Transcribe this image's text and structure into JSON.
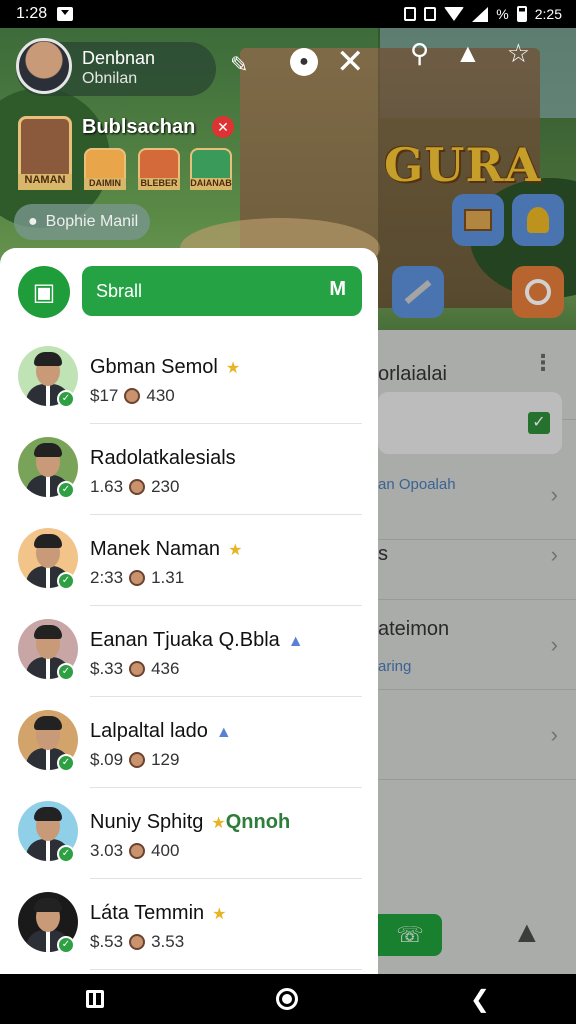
{
  "status_bar": {
    "time": "1:28",
    "right_text": "%",
    "battery_time": "2:25"
  },
  "header": {
    "profile_name": "Denbnan",
    "profile_sub": "Obnilan",
    "club_title": "Bublsachan",
    "club_avatar_label": "NAMAN",
    "mini_labels": [
      "DAIMIN",
      "BLEBER",
      "DAIANAB"
    ],
    "status_chip": "Bophie Manil",
    "icons": {
      "edit": "edit-icon",
      "chat_bubble": "chat-bubble-icon",
      "close": "close-icon"
    }
  },
  "scene": {
    "title": "GURA",
    "top_icons": [
      "search-icon",
      "notification-icon",
      "network-icon"
    ]
  },
  "drawer": {
    "chat_icon": "message-square-icon",
    "search_label": "Sbrall",
    "search_badge": "M",
    "friends": [
      {
        "name": "Gbman Semol",
        "amount": "$17",
        "count": "430",
        "badge": "star",
        "avatar_bg": "#bfe3b4"
      },
      {
        "name": "Radolatkalesials",
        "amount": "1.63",
        "count": "230",
        "badge": "",
        "avatar_bg": "#7aa35a"
      },
      {
        "name": "Manek Naman",
        "amount": "2:33",
        "count": "1.31",
        "badge": "star",
        "avatar_bg": "#f2c48a"
      },
      {
        "name": "Eanan Tjuaka Q.Bbla",
        "amount": "$.33",
        "count": "436",
        "badge": "hat",
        "avatar_bg": "#c9a6a6"
      },
      {
        "name": "Lalpaltal lado",
        "amount": "$.09",
        "count": "129",
        "badge": "hat",
        "avatar_bg": "#d2a36b"
      },
      {
        "name": "Nuniy Sphitg",
        "amount": "3.03",
        "count": "400",
        "badge": "star-ring",
        "badge_text": "Qnnoh",
        "avatar_bg": "#8fd0e8"
      },
      {
        "name": "Láta Temmin",
        "amount": "$.53",
        "count": "3.53",
        "badge": "star",
        "avatar_bg": "#1a1a1a"
      }
    ]
  },
  "right_panel": {
    "row1": "orlaialai",
    "row2_sub": "an Opoalah",
    "row3": "s",
    "row4": "ateimon",
    "row4_sub": "aring"
  },
  "colors": {
    "accent_green": "#1f9d3b",
    "verified_green": "#2ea043",
    "star_gold": "#e8b424"
  }
}
